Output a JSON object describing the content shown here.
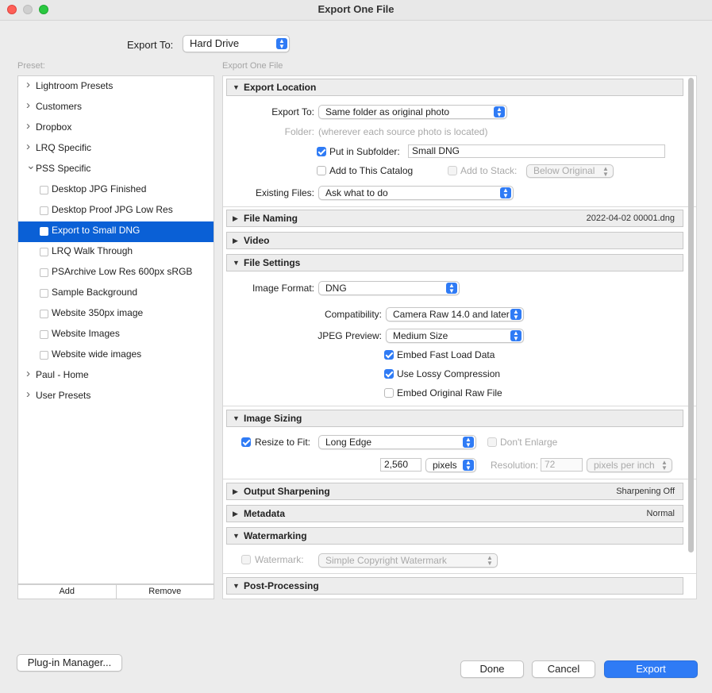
{
  "window": {
    "title": "Export One File"
  },
  "export_to": {
    "label": "Export To:",
    "value": "Hard Drive"
  },
  "preset": {
    "label": "Preset:",
    "items": [
      {
        "label": "Lightroom Presets",
        "kind": "folder",
        "expanded": false
      },
      {
        "label": "Customers",
        "kind": "folder",
        "expanded": false
      },
      {
        "label": "Dropbox",
        "kind": "folder",
        "expanded": false
      },
      {
        "label": "LRQ Specific",
        "kind": "folder",
        "expanded": false
      },
      {
        "label": "PSS Specific",
        "kind": "folder",
        "expanded": true
      },
      {
        "label": "Desktop JPG Finished",
        "kind": "child"
      },
      {
        "label": "Desktop Proof JPG Low Res",
        "kind": "child"
      },
      {
        "label": "Export to Small DNG",
        "kind": "child",
        "selected": true
      },
      {
        "label": "LRQ Walk Through",
        "kind": "child"
      },
      {
        "label": "PSArchive Low Res 600px sRGB",
        "kind": "child"
      },
      {
        "label": "Sample Background",
        "kind": "child"
      },
      {
        "label": "Website 350px image",
        "kind": "child"
      },
      {
        "label": "Website Images",
        "kind": "child"
      },
      {
        "label": "Website wide images",
        "kind": "child"
      },
      {
        "label": "Paul - Home",
        "kind": "folder",
        "expanded": false
      },
      {
        "label": "User Presets",
        "kind": "folder",
        "expanded": false
      }
    ],
    "add_label": "Add",
    "remove_label": "Remove"
  },
  "panel": {
    "label": "Export One File",
    "export_location": {
      "title": "Export Location",
      "export_to_label": "Export To:",
      "export_to_value": "Same folder as original photo",
      "folder_label": "Folder:",
      "folder_value": "(wherever each source photo is located)",
      "subfolder_label": "Put in Subfolder:",
      "subfolder_value": "Small DNG",
      "add_catalog_label": "Add to This Catalog",
      "add_stack_label": "Add to Stack:",
      "stack_value": "Below Original",
      "existing_label": "Existing Files:",
      "existing_value": "Ask what to do"
    },
    "file_naming": {
      "title": "File Naming",
      "summary": "2022-04-02 00001.dng"
    },
    "video": {
      "title": "Video"
    },
    "file_settings": {
      "title": "File Settings",
      "format_label": "Image Format:",
      "format_value": "DNG",
      "compat_label": "Compatibility:",
      "compat_value": "Camera Raw 14.0 and later",
      "jpeg_label": "JPEG Preview:",
      "jpeg_value": "Medium Size",
      "fast_load_label": "Embed Fast Load Data",
      "lossy_label": "Use Lossy Compression",
      "raw_label": "Embed Original Raw File"
    },
    "image_sizing": {
      "title": "Image Sizing",
      "resize_label": "Resize to Fit:",
      "resize_value": "Long Edge",
      "enlarge_label": "Don't Enlarge",
      "size_value": "2,560",
      "units_value": "pixels",
      "resolution_label": "Resolution:",
      "resolution_value": "72",
      "res_units_value": "pixels per inch"
    },
    "output_sharpening": {
      "title": "Output Sharpening",
      "summary": "Sharpening Off"
    },
    "metadata": {
      "title": "Metadata",
      "summary": "Normal"
    },
    "watermarking": {
      "title": "Watermarking",
      "watermark_label": "Watermark:",
      "watermark_value": "Simple Copyright Watermark"
    },
    "post_processing": {
      "title": "Post-Processing"
    }
  },
  "buttons": {
    "plugin_manager": "Plug-in Manager...",
    "done": "Done",
    "cancel": "Cancel",
    "export": "Export"
  },
  "colors": {
    "accent": "#2f7bf5",
    "selection": "#0a60d6"
  }
}
